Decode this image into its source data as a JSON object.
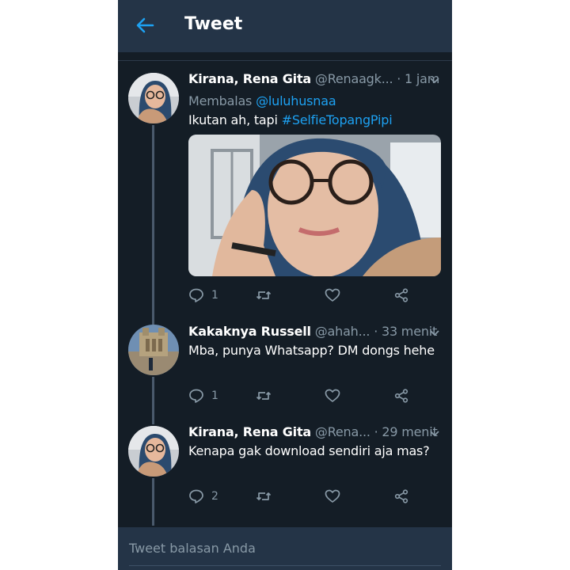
{
  "header": {
    "title": "Tweet"
  },
  "tweets": [
    {
      "name": "Kirana, Rena Gita",
      "handle": "@Renaagk...",
      "time": "· 1 jam",
      "replying_prefix": "Membalas ",
      "replying_to": "@luluhusnaa",
      "text_prefix": "Ikutan ah, tapi ",
      "hashtag": "#SelfieTopangPipi",
      "reply_count": "1"
    },
    {
      "name": "Kakaknya Russell",
      "handle": "@ahah...",
      "time": "· 33 menit",
      "text": "Mba, punya Whatsapp? DM dongs hehe",
      "reply_count": "1"
    },
    {
      "name": "Kirana, Rena Gita",
      "handle": "@Rena...",
      "time": "· 29 menit",
      "text": "Kenapa gak download sendiri aja mas?",
      "reply_count": "2"
    }
  ],
  "composer": {
    "placeholder": "Tweet balasan Anda"
  },
  "colors": {
    "background": "#141d26",
    "header": "#243447",
    "accent": "#1da1f2",
    "muted": "#8899a6"
  },
  "icons": [
    "back-arrow-icon",
    "chevron-down-icon",
    "reply-icon",
    "retweet-icon",
    "like-icon",
    "share-icon"
  ]
}
